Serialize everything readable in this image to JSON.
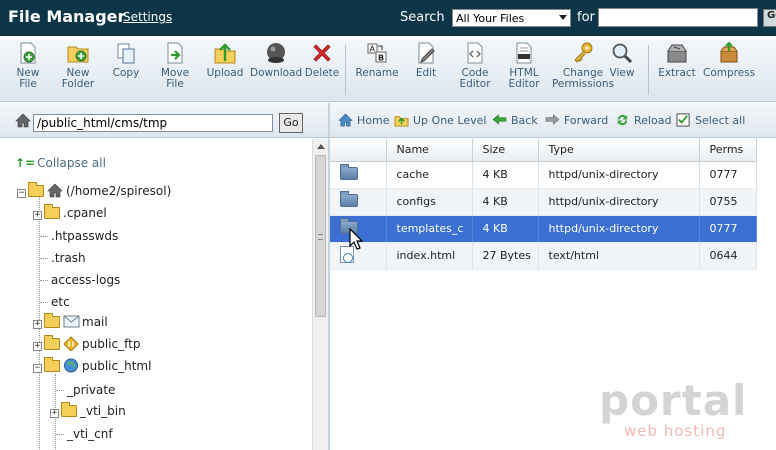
{
  "header": {
    "title": "File Manager",
    "settings_label": "Settings",
    "search_label": "Search",
    "search_scope": "All Your Files",
    "for_label": "for",
    "search_value": "",
    "go_label": "Go"
  },
  "toolbar": {
    "buttons": [
      {
        "label": "New\nFile",
        "icon": "new-file-icon"
      },
      {
        "label": "New\nFolder",
        "icon": "new-folder-icon"
      },
      {
        "label": "Copy",
        "icon": "copy-icon"
      },
      {
        "label": "Move\nFile",
        "icon": "move-file-icon"
      },
      {
        "label": "Upload",
        "icon": "upload-icon"
      },
      {
        "label": "Download",
        "icon": "download-icon"
      },
      {
        "label": "Delete",
        "icon": "delete-icon"
      },
      {
        "label": "Rename",
        "icon": "rename-icon"
      },
      {
        "label": "Edit",
        "icon": "edit-icon"
      },
      {
        "label": "Code\nEditor",
        "icon": "code-editor-icon"
      },
      {
        "label": "HTML\nEditor",
        "icon": "html-editor-icon"
      },
      {
        "label": "Change\nPermissions",
        "icon": "permissions-key-icon"
      },
      {
        "label": "View",
        "icon": "view-magnifier-icon"
      },
      {
        "label": "Extract",
        "icon": "extract-icon"
      },
      {
        "label": "Compress",
        "icon": "compress-icon"
      }
    ]
  },
  "pathbar": {
    "path": "/public_html/cms/tmp",
    "go_label": "Go"
  },
  "nav": {
    "home": "Home",
    "up_one_level": "Up One Level",
    "back": "Back",
    "forward": "Forward",
    "reload": "Reload",
    "select_all": "Select all"
  },
  "tree": {
    "collapse_all": "Collapse all",
    "root": "(/home2/spiresol)",
    "items": {
      "cpanel": ".cpanel",
      "htpasswds": ".htpasswds",
      "trash": ".trash",
      "access_logs": "access-logs",
      "etc": "etc",
      "mail": "mail",
      "public_ftp": "public_ftp",
      "public_html": "public_html",
      "private": "_private",
      "vti_bin": "_vti_bin",
      "vti_cnf": "_vti_cnf"
    }
  },
  "files": {
    "columns": [
      "Name",
      "Size",
      "Type",
      "Perms"
    ],
    "rows": [
      {
        "name": "cache",
        "size": "4 KB",
        "type": "httpd/unix-directory",
        "perms": "0777",
        "kind": "folder"
      },
      {
        "name": "configs",
        "size": "4 KB",
        "type": "httpd/unix-directory",
        "perms": "0755",
        "kind": "folder"
      },
      {
        "name": "templates_c",
        "size": "4 KB",
        "type": "httpd/unix-directory",
        "perms": "0777",
        "kind": "folder",
        "selected": true
      },
      {
        "name": "index.html",
        "size": "27 Bytes",
        "type": "text/html",
        "perms": "0644",
        "kind": "file"
      }
    ]
  },
  "watermark": {
    "brand": "portal",
    "tagline": "web hosting"
  }
}
